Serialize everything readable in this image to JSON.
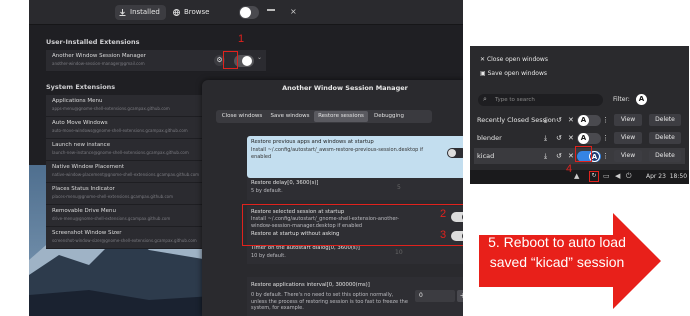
{
  "ext_app": {
    "tabs": [
      {
        "label": "Installed",
        "icon": "download-icon"
      },
      {
        "label": "Browse",
        "icon": "globe-icon"
      }
    ],
    "user_section_title": "User-Installed Extensions",
    "user_extensions": [
      {
        "name": "Another Window Session Manager",
        "id": "another-window-session-manager@gmail.com"
      }
    ],
    "system_section_title": "System Extensions",
    "system_extensions": [
      {
        "name": "Applications Menu",
        "id": "apps-menu@gnome-shell-extensions.gcampax.github.com"
      },
      {
        "name": "Auto Move Windows",
        "id": "auto-move-windows@gnome-shell-extensions.gcampax.github.com"
      },
      {
        "name": "Launch new instance",
        "id": "launch-new-instance@gnome-shell-extensions.gcampax.github.com"
      },
      {
        "name": "Native Window Placement",
        "id": "native-window-placement@gnome-shell-extensions.gcampax.github.com"
      },
      {
        "name": "Places Status Indicator",
        "id": "places-menu@gnome-shell-extensions.gcampax.github.com"
      },
      {
        "name": "Removable Drive Menu",
        "id": "drive-menu@gnome-shell-extensions.gcampax.github.com"
      },
      {
        "name": "Screenshot Window Sizer",
        "id": "screenshot-window-sizer@gnome-shell-extensions.gcampax.github.com"
      }
    ]
  },
  "dialog": {
    "title": "Another Window Session Manager",
    "tabs": [
      "Close windows",
      "Save windows",
      "Restore sessions",
      "Debugging"
    ],
    "active_tab": "Restore sessions",
    "restore_prev": {
      "title": "Restore previous apps and windows at startup",
      "desc": "Install ~/.config/autostart/_awsm-restore-previous-session.desktop if enabled"
    },
    "restore_delay": {
      "title": "Restore delay[0, 3600(s)]",
      "desc": "5 by default."
    },
    "restore_selected": {
      "title": "Restore selected session at startup",
      "desc": "Install ~/.config/autostart/_gnome-shell-extension-another-window-session-manager.desktop if enabled"
    },
    "restore_no_ask": {
      "title": "Restore at startup without asking"
    },
    "timer": {
      "title": "Timer on the autostart dialog[0, 3600(s)]",
      "desc": "10 by default.",
      "value": "10"
    },
    "interval": {
      "title": "Restore applications interval[0, 300000(ms)]",
      "desc": "0 by default. There's no need to set this option normally, unless the process of restoring session is too fast to freeze the system, for example.",
      "value": "0"
    }
  },
  "panel": {
    "menu_items": [
      {
        "label": "Close open windows",
        "icon": "close-icon"
      },
      {
        "label": "Save open windows",
        "icon": "save-icon"
      }
    ],
    "search_placeholder": "Type to search",
    "filter_label": "Filter:",
    "filter_badge": "A",
    "sessions": [
      {
        "name": "Recently Closed Session",
        "view": "View",
        "delete": "Delete",
        "badge": "A"
      },
      {
        "name": "blender",
        "view": "View",
        "delete": "Delete",
        "badge": "A"
      },
      {
        "name": "kicad",
        "view": "View",
        "delete": "Delete",
        "badge": "A"
      }
    ],
    "clock": "Apr 23  18:50"
  },
  "annotations": {
    "n1": "1",
    "n2": "2",
    "n3": "3",
    "n4": "4",
    "arrow_line1": "5. Reboot to auto load",
    "arrow_line2": "saved “kicad” session"
  },
  "colors": {
    "annotation_red": "#e0221d",
    "switch_on": "#3584e4",
    "dialog_bg": "#2a2a2e"
  }
}
